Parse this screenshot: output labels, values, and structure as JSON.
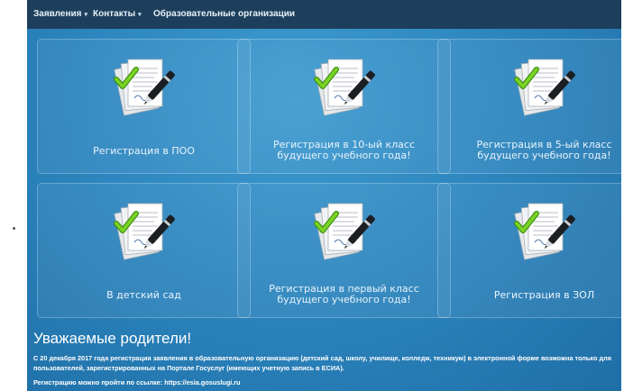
{
  "nav": {
    "items": [
      {
        "label": "Заявления",
        "has_dropdown": true
      },
      {
        "label": "Контакты",
        "has_dropdown": true
      },
      {
        "label": "Образовательные организации",
        "has_dropdown": false
      }
    ],
    "caret": "▾"
  },
  "tiles": [
    {
      "label_lines": [
        "Регистрация в ПОО"
      ],
      "icon": "signed-documents-icon"
    },
    {
      "label_lines": [
        "Регистрация в 10-ый класс",
        "будущего учебного года!"
      ],
      "icon": "signed-documents-icon"
    },
    {
      "label_lines": [
        "Регистрация в 5-ый класс",
        "будущего учебного года!"
      ],
      "icon": "signed-documents-icon"
    },
    {
      "label_lines": [
        "В детский сад"
      ],
      "icon": "signed-documents-icon"
    },
    {
      "label_lines": [
        "Регистрация в первый класс",
        "будущего учебного года!"
      ],
      "icon": "signed-documents-icon"
    },
    {
      "label_lines": [
        "Регистрация в ЗОЛ"
      ],
      "icon": "signed-documents-icon"
    }
  ],
  "notice": {
    "heading": "Уважаемые родители!",
    "text": "С 20 декабря 2017 года регистрация заявления в образовательную организацию (детский сад, школу, училище, колледж, техникум) в электронной форме возможна только для пользователей, зарегистрированных на Портале Госуслуг (имеющих учетную запись в ЕСИА).",
    "link_line": "Регистрацию можно пройти по ссылке: https://esia.gosuslugi.ru"
  },
  "colors": {
    "navbar": "#1d3f5c",
    "background": "#2d86bf",
    "check": "#6cc417"
  }
}
